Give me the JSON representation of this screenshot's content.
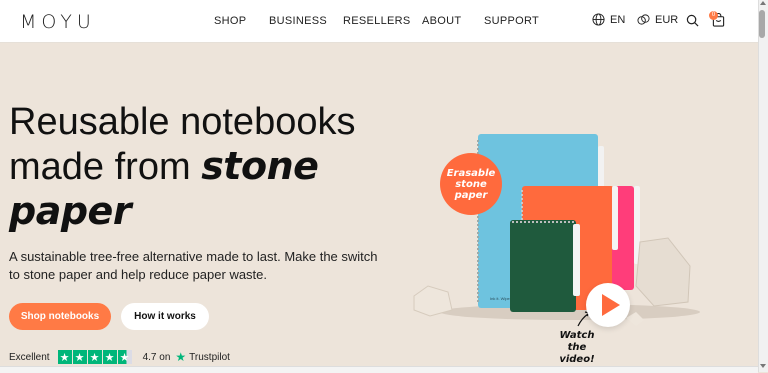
{
  "header": {
    "logo": "MOYU",
    "nav": [
      "SHOP",
      "BUSINESS",
      "RESELLERS",
      "ABOUT",
      "SUPPORT"
    ],
    "language": "EN",
    "currency": "EUR",
    "cart_count": "0",
    "icons": [
      "globe-icon",
      "currency-icon",
      "search-icon",
      "cart-icon"
    ]
  },
  "hero": {
    "title_line1": "Reusable notebooks",
    "title_line2_plain": "made from",
    "title_line2_hand": "stone",
    "title_line3_hand": "paper",
    "subtitle": "A sustainable tree-free alternative made to last. Make the switch to stone paper and help reduce paper waste.",
    "primary_button": "Shop notebooks",
    "secondary_button": "How it works"
  },
  "trust": {
    "label": "Excellent",
    "rating": "4.7 on",
    "brand": "Trustpilot",
    "stars_value": 4.5,
    "stars_max": 5
  },
  "illustration": {
    "badge_line1": "Erasable",
    "badge_line2": "stone",
    "badge_line3": "paper",
    "watch_line1": "Watch the",
    "watch_line2": "video!",
    "notebook_text": "Ink it. Wipe it. Love it.",
    "colors": {
      "notebook_blue": "#6ec3df",
      "notebook_orange": "#ff6a3d",
      "notebook_pink": "#ff3d7a",
      "notebook_green": "#1f5a3d",
      "accent": "#ff7a45",
      "trustpilot_green": "#00b67a"
    }
  }
}
